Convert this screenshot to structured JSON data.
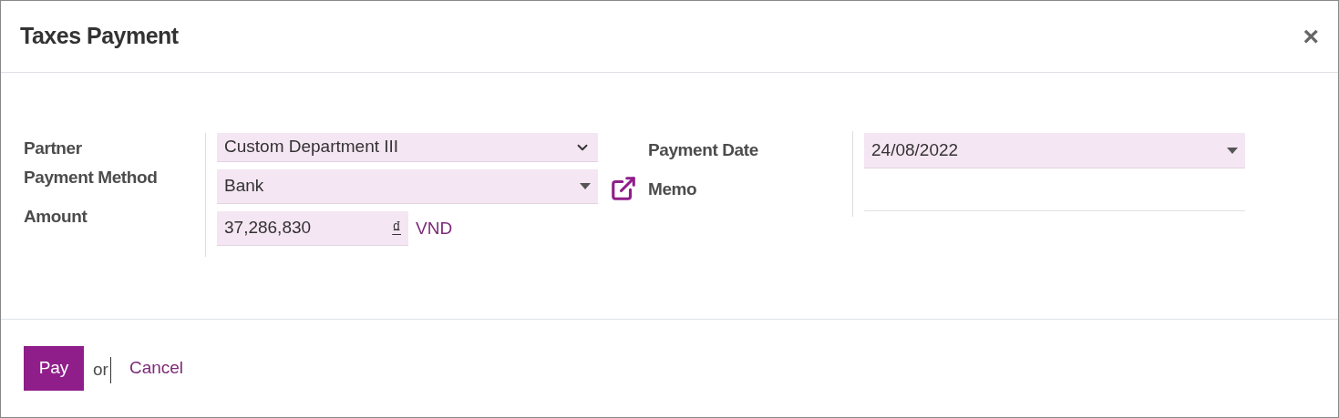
{
  "dialog": {
    "title": "Taxes Payment",
    "close": "×"
  },
  "left_fields": [
    {
      "label": "Partner",
      "kind": "chevron-select",
      "value": "Custom Department III"
    },
    {
      "label": "Payment Method",
      "kind": "caret-select",
      "value": "Bank"
    },
    {
      "label": "Amount",
      "kind": "money",
      "value": "37,286,830",
      "symbol": "₫",
      "currency": "VND"
    }
  ],
  "right_fields": [
    {
      "label": "Payment Date",
      "kind": "caret-select",
      "value": "24/08/2022"
    },
    {
      "label": "Memo",
      "kind": "text"
    }
  ],
  "footer": {
    "primary": "Pay",
    "separator": "or",
    "secondary": "Cancel"
  }
}
